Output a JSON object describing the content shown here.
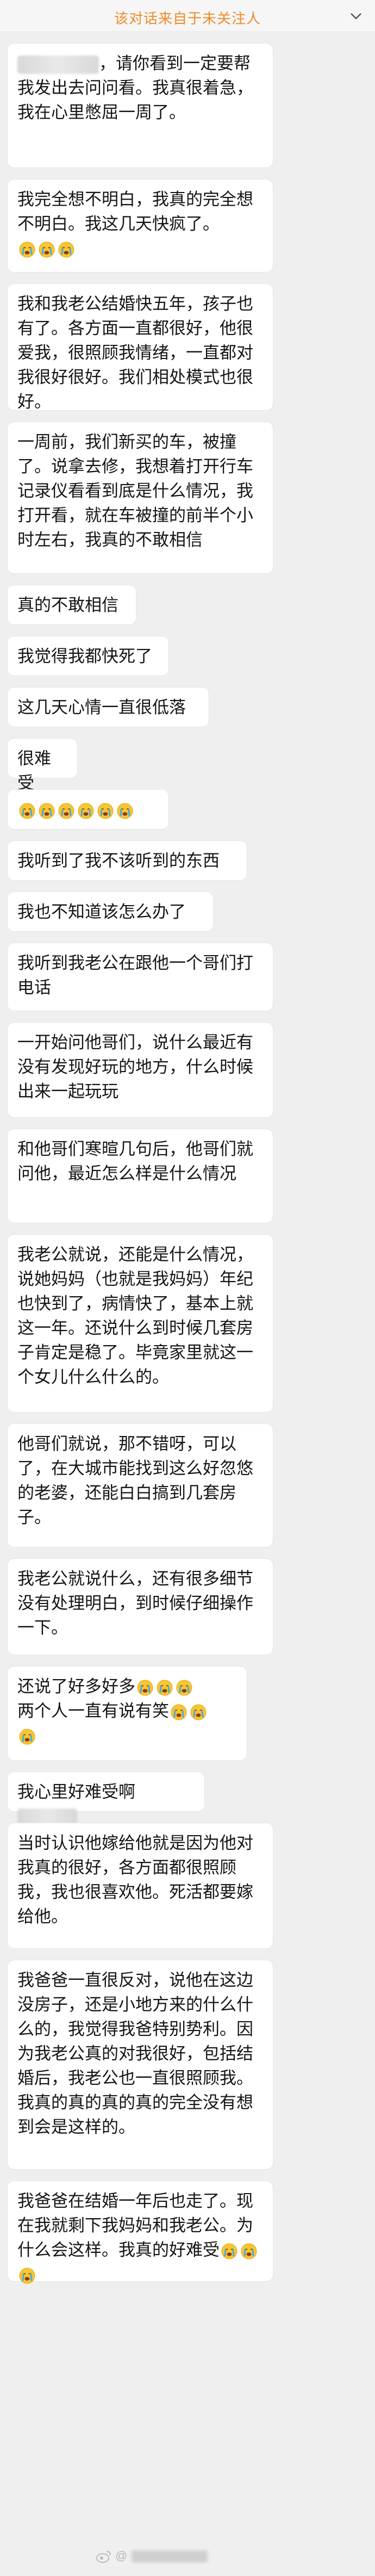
{
  "header": {
    "title": "该对话来自于未关注人",
    "chevron_icon": "chevron-down-icon"
  },
  "messages": [
    {
      "text": "，请你看到一定要帮我发出去问问看。我真很着急，我在心里憋屈一周了。",
      "masked_prefix": true
    },
    {
      "text": "我完全想不明白，我真的完全想不明白。我这几天快疯了。",
      "emoji_count": 3
    },
    {
      "text": "我和我老公结婚快五年，孩子也有了。各方面一直都很好，他很爱我，很照顾我情绪，一直都对我很好很好。我们相处模式也很好。"
    },
    {
      "text": "一周前，我们新买的车，被撞了。说拿去修，我想着打开行车记录仪看看到底是什么情况，我打开看，就在车被撞的前半个小时左右，我真的不敢相信"
    },
    {
      "text": "真的不敢相信"
    },
    {
      "text": "我觉得我都快死了"
    },
    {
      "text": "这几天心情一直很低落"
    },
    {
      "text": "很难受"
    },
    {
      "text": "",
      "emoji_count": 6
    },
    {
      "text": "我听到了我不该听到的东西"
    },
    {
      "text": "我也不知道该怎么办了"
    },
    {
      "text": "我听到我老公在跟他一个哥们打电话"
    },
    {
      "text": "一开始问他哥们，说什么最近有没有发现好玩的地方，什么时候出来一起玩玩"
    },
    {
      "text": "和他哥们寒暄几句后，他哥们就问他，最近怎么样是什么情况"
    },
    {
      "text": "我老公就说，还能是什么情况，说她妈妈（也就是我妈妈）年纪也快到了，病情快了，基本上就这一年。还说什么到时候几套房子肯定是稳了。毕竟家里就这一个女儿什么什么的。"
    },
    {
      "text": "他哥们就说，那不错呀，可以了，在大城市能找到这么好忽悠的老婆，还能白白搞到几套房子。"
    },
    {
      "text": "我老公就说什么，还有很多细节没有处理明白，到时候仔细操作一下。"
    },
    {
      "text": "还说了好多好多",
      "emoji_count": 3,
      "text2": "两个人一直有说有笑",
      "emoji_count2": 2,
      "emoji_count3": 1
    },
    {
      "text": "我心里好难受啊",
      "masked_suffix": true
    },
    {
      "text": "当时认识他嫁给他就是因为他对我真的很好，各方面都很照顾我，我也很喜欢他。死活都要嫁给他。"
    },
    {
      "text": "我爸爸一直很反对，说他在这边没房子，还是小地方来的什么什么的，我觉得我爸特别势利。因为我老公真的对我很好，包括结婚后，我老公也一直很照顾我。我真的真的真的真的完全没有想到会是这样的。"
    },
    {
      "text": "我爸爸在结婚一年后也走了。现在我就剩下我妈妈和我老公。为什么会这样。我真的好难受",
      "emoji_count": 3
    }
  ],
  "emoji_icon": "crying-face-icon",
  "watermark": {
    "text": "@",
    "icon": "weibo-logo-icon"
  },
  "colors": {
    "title": "#f08a28",
    "bubble": "#ffffff",
    "background": "#efefef",
    "text": "#151515"
  }
}
